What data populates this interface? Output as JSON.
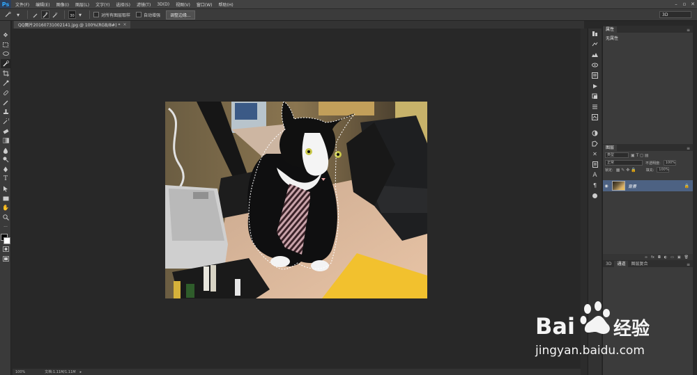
{
  "app": {
    "logo": "Ps"
  },
  "menu": [
    "文件(F)",
    "编辑(E)",
    "图像(I)",
    "图层(L)",
    "文字(Y)",
    "选择(S)",
    "滤镜(T)",
    "3D(D)",
    "视图(V)",
    "窗口(W)",
    "帮助(H)"
  ],
  "window_controls": [
    "–",
    "▫",
    "✕"
  ],
  "options_bar": {
    "brush_size": "30",
    "sample_all_layers": "对所有图层取样",
    "auto_enhance": "自动增强",
    "refine_edge_button": "调整边缘...",
    "workspace": "3D"
  },
  "document": {
    "tab_title": "QQ图片20160731002141.jpg @ 100%(RGB/8#) *",
    "tab_close": "×"
  },
  "status_bar": {
    "zoom": "100%",
    "doc_info": "文档:1.11M/1.11M"
  },
  "properties_panel": {
    "tab": "属性",
    "content": "无属性"
  },
  "layers_panel": {
    "tabs": [
      "图层"
    ],
    "kind_filter": "类型",
    "blend_mode": "正常",
    "opacity_label": "不透明度:",
    "opacity_value": "100%",
    "lock_label": "锁定:",
    "fill_label": "填充:",
    "fill_value": "100%",
    "layer_name": "背景"
  },
  "bottom_panel": {
    "tabs": [
      "3D",
      "通道",
      "图层复合"
    ]
  },
  "watermark": {
    "brand": "Bai",
    "brand_suffix": "经验",
    "url": "jingyan.baidu.com"
  },
  "colors": {
    "photoshop_blue": "#31a8ff",
    "selected_layer": "#4d6283",
    "canvas_bg": "#282828"
  }
}
